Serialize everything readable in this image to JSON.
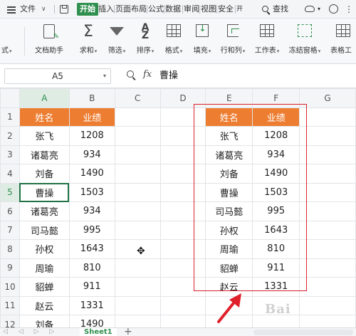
{
  "menubar": {
    "file": "文件",
    "tabs": [
      "开始",
      "插入",
      "页面布局",
      "公式",
      "数据",
      "审阅",
      "视图",
      "安全",
      "开"
    ],
    "search": "查找"
  },
  "ribbon": {
    "items": [
      {
        "label": "式",
        "caret": "▾"
      },
      {
        "label": "文档助手",
        "caret": ""
      },
      {
        "label": "求和",
        "caret": "▾"
      },
      {
        "label": "筛选",
        "caret": "▾"
      },
      {
        "label": "排序",
        "caret": "▾"
      },
      {
        "label": "格式",
        "caret": "▾"
      },
      {
        "label": "填充",
        "caret": "▾"
      },
      {
        "label": "行和列",
        "caret": "▾"
      },
      {
        "label": "工作表",
        "caret": "▾"
      },
      {
        "label": "冻结窗格",
        "caret": "▾"
      },
      {
        "label": "表格工",
        "caret": ""
      }
    ]
  },
  "formula_bar": {
    "name_box": "A5",
    "fx": "fx",
    "value": "曹操"
  },
  "grid": {
    "columns": [
      "A",
      "B",
      "C",
      "D",
      "E",
      "F",
      "G"
    ],
    "rows": [
      "1",
      "2",
      "3",
      "4",
      "5",
      "6",
      "7",
      "8",
      "9",
      "10",
      "11",
      "12"
    ],
    "active_cell": "A5",
    "cells": [
      [
        "姓名",
        "业绩",
        "",
        "",
        "姓名",
        "业绩",
        ""
      ],
      [
        "张飞",
        "1208",
        "",
        "",
        "张飞",
        "1208",
        ""
      ],
      [
        "诸葛亮",
        "934",
        "",
        "",
        "诸葛亮",
        "934",
        ""
      ],
      [
        "刘备",
        "1490",
        "",
        "",
        "刘备",
        "1490",
        ""
      ],
      [
        "曹操",
        "1503",
        "",
        "",
        "曹操",
        "1503",
        ""
      ],
      [
        "诸葛亮",
        "934",
        "",
        "",
        "司马懿",
        "995",
        ""
      ],
      [
        "司马懿",
        "995",
        "",
        "",
        "孙权",
        "1643",
        ""
      ],
      [
        "孙权",
        "1643",
        "",
        "",
        "周瑜",
        "810",
        ""
      ],
      [
        "周瑜",
        "810",
        "",
        "",
        "貂蝉",
        "911",
        ""
      ],
      [
        "貂蝉",
        "911",
        "",
        "",
        "赵云",
        "1331",
        ""
      ],
      [
        "赵云",
        "1331",
        "",
        "",
        "",
        "",
        ""
      ],
      [
        "刘备",
        "1490",
        "",
        "",
        "",
        "",
        ""
      ]
    ]
  },
  "sheets": {
    "nav": "◁ ◁ ▷ ▷",
    "active": "Sheet1",
    "add": "+"
  },
  "colors": {
    "header_fill": "#ed7d31",
    "accent_green": "#2f8f4f",
    "highlight_box": "#d9222a"
  },
  "watermark": "Bai"
}
